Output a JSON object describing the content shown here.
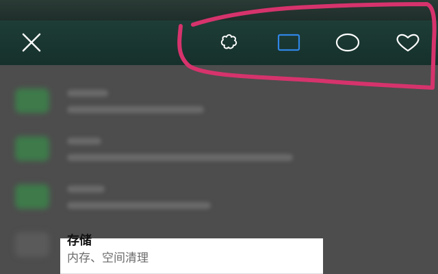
{
  "toolbar": {
    "close_icon": "close-icon",
    "shapes": [
      {
        "icon": "puzzle-icon",
        "selected": false
      },
      {
        "icon": "square-icon",
        "selected": true
      },
      {
        "icon": "circle-icon",
        "selected": false
      },
      {
        "icon": "heart-icon",
        "selected": false
      }
    ]
  },
  "settings_item": {
    "title": "存储",
    "subtitle": "内存、空间清理"
  },
  "colors": {
    "toolbar_bg": "#1e3d37",
    "selected_icon": "#2f86e6",
    "icon": "#ffffff",
    "annotation": "#d6336c",
    "blurred_icon_green": "#3e7a4a"
  }
}
